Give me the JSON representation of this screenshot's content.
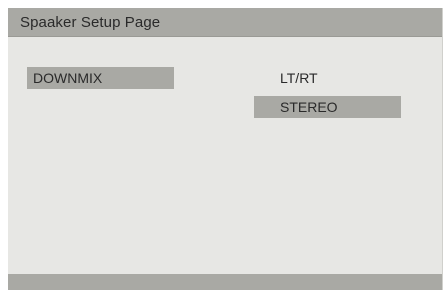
{
  "page": {
    "title": "Spaaker Setup Page"
  },
  "menu": {
    "items": [
      {
        "label": "DOWNMIX"
      }
    ]
  },
  "options": {
    "items": [
      {
        "label": "LT/RT",
        "selected": false
      },
      {
        "label": "STEREO",
        "selected": true
      }
    ]
  },
  "colors": {
    "background": "#e7e7e4",
    "bar": "#a9a9a4",
    "text": "#2a2a2a"
  }
}
